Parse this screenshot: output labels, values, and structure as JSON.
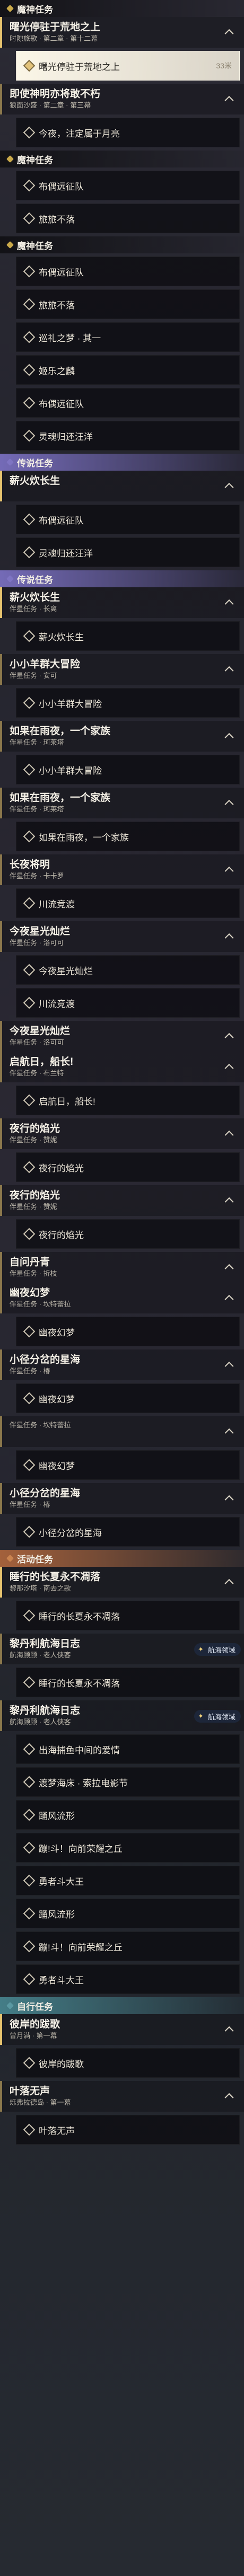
{
  "sections": [
    {
      "label": "魔神任务",
      "color": "#c9a94a",
      "style": "plain",
      "quests": [
        {
          "title": "曙光停驻于荒地之上",
          "sub": "时隙旅歌 · 第二章 · 第十二幕",
          "objectives": []
        },
        {
          "title": "",
          "sub": "",
          "objectives": [
            {
              "text": "曙光停驻于荒地之上",
              "distance": "33米",
              "highlight": true
            }
          ]
        },
        {
          "title": "即使神明亦将敢不朽",
          "sub": "狼面沙盛 · 第二章 · 第三幕",
          "objectives": [
            {
              "text": "今夜，注定属于月亮"
            }
          ]
        }
      ]
    },
    {
      "label": "魔神任务",
      "color": "#c9a94a",
      "style": "plain",
      "quests": [
        {
          "title": "",
          "sub": "",
          "objectives": [
            {
              "text": "布偶远征队"
            },
            {
              "text": "旅旅不落"
            }
          ]
        }
      ]
    },
    {
      "label": "魔神任务",
      "color": "#c9a94a",
      "style": "plain",
      "quests": [
        {
          "title": "",
          "sub": "",
          "objectives": [
            {
              "text": "布偶远征队"
            },
            {
              "text": "旅旅不落"
            },
            {
              "text": "巡礼之梦 · 其一"
            },
            {
              "text": "姬乐之麟"
            },
            {
              "text": "布偶远征队"
            },
            {
              "text": "灵魂归还汪洋"
            }
          ]
        }
      ]
    },
    {
      "label": "传说任务",
      "color": "#7e74c2",
      "style": "purple",
      "quests": [
        {
          "title": "薪火炊长生",
          "sub": "",
          "objectives": [
            {
              "text": "布偶远征队"
            },
            {
              "text": "灵魂归还汪洋"
            }
          ]
        }
      ]
    },
    {
      "label": "传说任务",
      "color": "#7e74c2",
      "style": "purple",
      "quests": [
        {
          "title": "薪火炊长生",
          "sub": "伴星任务 · 长离",
          "objectives": [
            {
              "text": "薪火炊长生"
            }
          ]
        },
        {
          "title": "小小羊群大冒险",
          "sub": "伴星任务 · 安可",
          "objectives": [
            {
              "text": "小小羊群大冒险"
            }
          ]
        },
        {
          "title": "如果在雨夜，一个家族",
          "sub": "伴星任务 · 珂莱塔",
          "objectives": [
            {
              "text": "小小羊群大冒险"
            }
          ]
        },
        {
          "title": "如果在雨夜，一个家族",
          "sub": "伴星任务 · 珂莱塔",
          "objectives": [
            {
              "text": "如果在雨夜，一个家族"
            }
          ]
        },
        {
          "title": "长夜将明",
          "sub": "伴星任务 · 卡卡罗",
          "objectives": [
            {
              "text": "川流竞渡"
            }
          ]
        },
        {
          "title": "今夜星光灿烂",
          "sub": "伴星任务 · 洛可可",
          "objectives": [
            {
              "text": "今夜星光灿烂"
            },
            {
              "text": "川流竞渡"
            }
          ]
        },
        {
          "title": "今夜星光灿烂",
          "sub": "伴星任务 · 洛可可",
          "objectives": []
        },
        {
          "title": "启航日，船长!",
          "sub": "伴星任务 · 布兰特",
          "objectives": [
            {
              "text": "启航日，船长!"
            }
          ]
        },
        {
          "title": "夜行的焰光",
          "sub": "伴星任务 · 赞妮",
          "objectives": [
            {
              "text": "夜行的焰光"
            }
          ]
        },
        {
          "title": "夜行的焰光",
          "sub": "伴星任务 · 赞妮",
          "objectives": [
            {
              "text": "夜行的焰光"
            }
          ]
        },
        {
          "title": "自问丹青",
          "sub": "伴星任务 · 折枝",
          "objectives": []
        },
        {
          "title": "幽夜幻梦",
          "sub": "伴星任务 · 坎特蕾拉",
          "objectives": [
            {
              "text": "幽夜幻梦"
            }
          ]
        },
        {
          "title": "小径分岔的星海",
          "sub": "伴星任务 · 椿",
          "objectives": [
            {
              "text": "幽夜幻梦"
            }
          ]
        },
        {
          "title": "",
          "sub": "伴星任务 · 坎特蕾拉",
          "objectives": [
            {
              "text": "幽夜幻梦"
            }
          ]
        },
        {
          "title": "小径分岔的星海",
          "sub": "伴星任务 · 椿",
          "objectives": [
            {
              "text": "小径分岔的星海"
            }
          ]
        }
      ]
    },
    {
      "label": "活动任务",
      "color": "#c9834f",
      "style": "orange",
      "quests": [
        {
          "title": "睡行的长夏永不凋落",
          "sub": "黎那汐塔 · 南去之歌",
          "objectives": [
            {
              "text": "睡行的长夏永不凋落"
            }
          ],
          "badge": ""
        },
        {
          "title": "黎丹利航海日志",
          "sub": "航海顾顾 · 老人侠客",
          "objectives": [
            {
              "text": "睡行的长夏永不凋落"
            }
          ],
          "badge": "航海领域"
        },
        {
          "title": "黎丹利航海日志",
          "sub": "航海顾顾 · 老人侠客",
          "objectives": [
            {
              "text": "出海捕鱼中间的爱情"
            },
            {
              "text": "渡梦海床 · 索拉电影节"
            },
            {
              "text": "踊风流形"
            },
            {
              "text": "蹦!斗！向前荣耀之丘"
            },
            {
              "text": "勇者斗大王"
            }
          ],
          "badge": "航海领域"
        },
        {
          "title": "",
          "sub": "",
          "objectives": [
            {
              "text": "踊风流形"
            },
            {
              "text": "蹦!斗！向前荣耀之丘"
            },
            {
              "text": "勇者斗大王"
            }
          ],
          "badge": ""
        }
      ]
    },
    {
      "label": "自行任务",
      "color": "#5a98a2",
      "style": "teal",
      "quests": [
        {
          "title": "彼岸的跋歌",
          "sub": "曾月满 · 第一幕",
          "objectives": [
            {
              "text": "彼岸的跋歌"
            }
          ]
        },
        {
          "title": "叶落无声",
          "sub": "烁弗拉德岛 · 第一幕",
          "objectives": [
            {
              "text": "叶落无声"
            }
          ]
        }
      ]
    }
  ]
}
